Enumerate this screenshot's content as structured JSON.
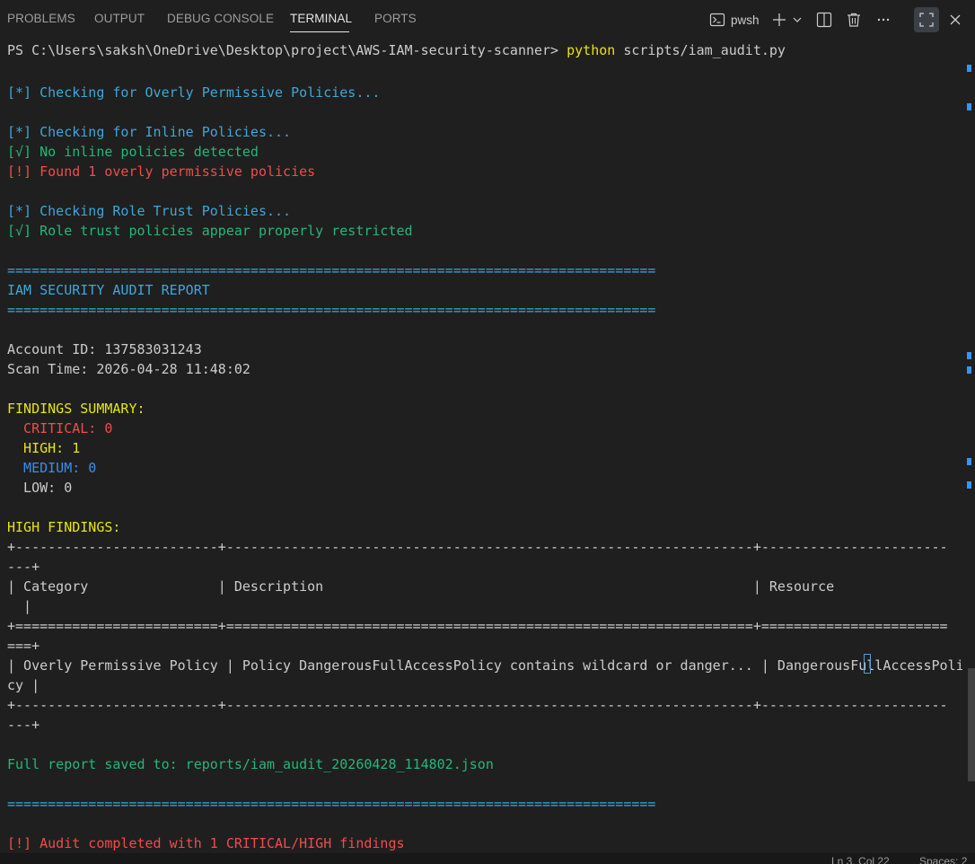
{
  "tabs": [
    "PROBLEMS",
    "OUTPUT",
    "DEBUG CONSOLE",
    "TERMINAL",
    "PORTS"
  ],
  "active_tab": "TERMINAL",
  "toolbar": {
    "shell_label": "pwsh"
  },
  "terminal": {
    "prompt": "PS C:\\Users\\saksh\\OneDrive\\Desktop\\project\\AWS-IAM-security-scanner>",
    "command": "python",
    "command_args": "scripts/iam_audit.py",
    "lines": {
      "l1": "[*] Checking for Overly Permissive Policies...",
      "l2": "[*] Checking for Inline Policies...",
      "l3": "[√] No inline policies detected",
      "l4": "[!] Found 1 overly permissive policies",
      "l5": "[*] Checking Role Trust Policies...",
      "l6": "[√] Role trust policies appear properly restricted",
      "rule": "================================================================================",
      "report_title": "IAM SECURITY AUDIT REPORT",
      "account_id": "Account ID: 137583031243",
      "scan_time": "Scan Time: 2026-04-28 11:48:02",
      "summary_title": "FINDINGS SUMMARY:",
      "critical": "  CRITICAL: 0",
      "high": "  HIGH: 1",
      "medium": "  MEDIUM: 0",
      "low": "  LOW: 0",
      "high_findings": "HIGH FINDINGS:",
      "tbl_border_a": "+-------------------------+-----------------------------------------------------------------+-----------------------",
      "tbl_border_a_wrap": "---+",
      "tbl_header": "| Category                | Description                                                     | Resource",
      "tbl_header_wrap": "  |",
      "tbl_border_b": "+=========================+=================================================================+=======================",
      "tbl_border_b_wrap": "===+",
      "tbl_row": "| Overly Permissive Policy | Policy DangerousFullAccessPolicy contains wildcard or danger... | DangerousFullAccessPoli",
      "tbl_row_wrap": "cy |",
      "tbl_border_c": "+-------------------------+-----------------------------------------------------------------+-----------------------",
      "tbl_border_c_wrap": "---+",
      "saved": "Full report saved to: reports/iam_audit_20260428_114802.json",
      "final": "[!] Audit completed with 1 CRITICAL/HIGH findings"
    }
  },
  "status_bar": {
    "position": "Ln 3, Col 22",
    "spaces": "Spaces: 2"
  },
  "colors": {
    "background": "#1f1f1f",
    "info_blue": "#3ea7d8",
    "ok_green": "#23b877",
    "error_red": "#f14c4c",
    "warn_yellow": "#e5e510",
    "accent_blue": "#3794ff"
  }
}
